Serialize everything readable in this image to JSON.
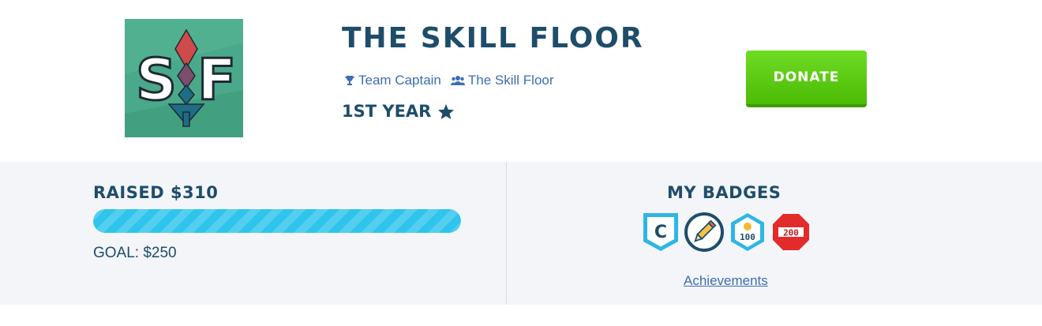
{
  "profile": {
    "avatar_letters": [
      "S",
      "F"
    ],
    "name": "THE SKILL FLOOR",
    "role": "Team Captain",
    "role_icon": "trophy-icon",
    "team": "The Skill Floor",
    "team_icon": "users-icon",
    "tenure": "1ST YEAR",
    "tenure_icon": "star-icon"
  },
  "donate": {
    "label": "DONATE"
  },
  "fundraising": {
    "raised_label": "RAISED $310",
    "goal_label": "GOAL: $250",
    "progress_fraction": 1.0
  },
  "badges": {
    "title": "MY BADGES",
    "items": [
      {
        "name": "captain-badge",
        "label": "C"
      },
      {
        "name": "pencil-badge"
      },
      {
        "name": "donation-100-badge",
        "label": "100"
      },
      {
        "name": "stop-200-badge",
        "label": "200"
      }
    ],
    "link": "Achievements"
  },
  "colors": {
    "primary_text": "#1e4d6b",
    "link": "#3d6db5",
    "donate_green": "#5cc614",
    "progress": "#2ec4ec",
    "panel_bg": "#f3f5f8"
  }
}
